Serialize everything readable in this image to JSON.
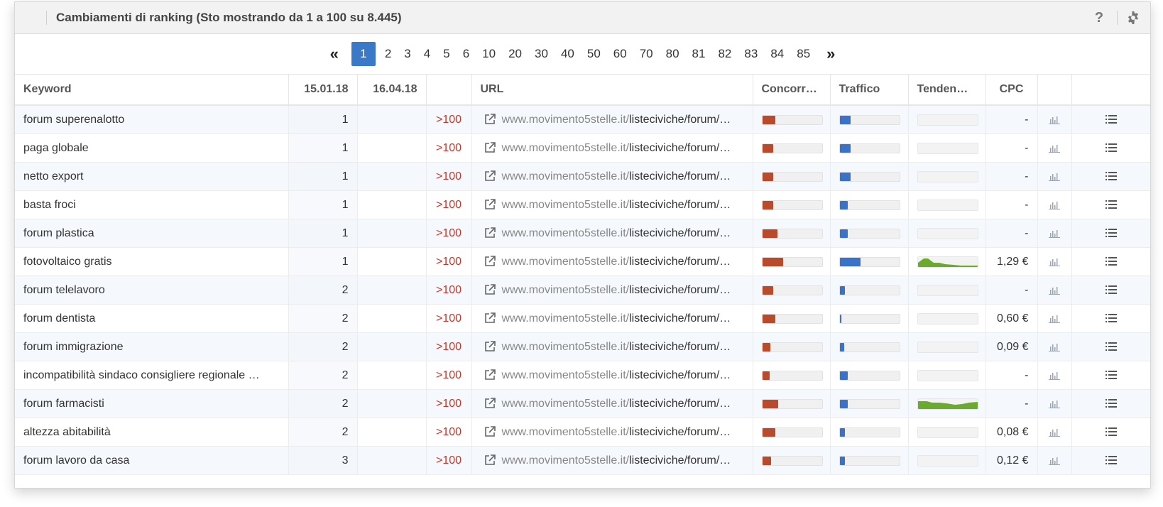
{
  "header": {
    "title": "Cambiamenti di ranking (Sto mostrando da 1 a 100 su 8.445)",
    "help_label": "?"
  },
  "pager": {
    "prev_label": "«",
    "next_label": "»",
    "pages": [
      "1",
      "2",
      "3",
      "4",
      "5",
      "6",
      "10",
      "20",
      "30",
      "40",
      "50",
      "60",
      "70",
      "80",
      "81",
      "82",
      "83",
      "84",
      "85"
    ],
    "current": "1"
  },
  "columns": {
    "keyword": "Keyword",
    "date1": "15.01.18",
    "date2": "16.04.18",
    "change": "",
    "url": "URL",
    "competition": "Concorr…",
    "traffic": "Traffico",
    "trend": "Tenden…",
    "cpc": "CPC"
  },
  "colors": {
    "accent": "#3a78c8",
    "competition_bar": "#b94a2c",
    "traffic_bar": "#3a72c9",
    "trend_fill": "#6aaa2e",
    "change_text": "#c0392b"
  },
  "rows": [
    {
      "keyword": "forum superenalotto",
      "d1": "1",
      "d2": "",
      "change": ">100",
      "domain": "www.movimento5stelle.it/",
      "path": "listeciviche/forum/…",
      "competition": 0.22,
      "traffic": 0.18,
      "trend": "",
      "cpc": "-"
    },
    {
      "keyword": "paga globale",
      "d1": "1",
      "d2": "",
      "change": ">100",
      "domain": "www.movimento5stelle.it/",
      "path": "listeciviche/forum/…",
      "competition": 0.19,
      "traffic": 0.19,
      "trend": "",
      "cpc": "-"
    },
    {
      "keyword": "netto export",
      "d1": "1",
      "d2": "",
      "change": ">100",
      "domain": "www.movimento5stelle.it/",
      "path": "listeciviche/forum/…",
      "competition": 0.18,
      "traffic": 0.18,
      "trend": "",
      "cpc": "-"
    },
    {
      "keyword": "basta froci",
      "d1": "1",
      "d2": "",
      "change": ">100",
      "domain": "www.movimento5stelle.it/",
      "path": "listeciviche/forum/…",
      "competition": 0.19,
      "traffic": 0.14,
      "trend": "",
      "cpc": "-"
    },
    {
      "keyword": "forum plastica",
      "d1": "1",
      "d2": "",
      "change": ">100",
      "domain": "www.movimento5stelle.it/",
      "path": "listeciviche/forum/…",
      "competition": 0.25,
      "traffic": 0.14,
      "trend": "",
      "cpc": "-"
    },
    {
      "keyword": "fotovoltaico gratis",
      "d1": "1",
      "d2": "",
      "change": ">100",
      "domain": "www.movimento5stelle.it/",
      "path": "listeciviche/forum/…",
      "competition": 0.35,
      "traffic": 0.35,
      "trend": "high",
      "cpc": "1,29 €"
    },
    {
      "keyword": "forum telelavoro",
      "d1": "2",
      "d2": "",
      "change": ">100",
      "domain": "www.movimento5stelle.it/",
      "path": "listeciviche/forum/…",
      "competition": 0.18,
      "traffic": 0.09,
      "trend": "",
      "cpc": "-"
    },
    {
      "keyword": "forum dentista",
      "d1": "2",
      "d2": "",
      "change": ">100",
      "domain": "www.movimento5stelle.it/",
      "path": "listeciviche/forum/…",
      "competition": 0.22,
      "traffic": 0.03,
      "trend": "",
      "cpc": "0,60 €"
    },
    {
      "keyword": "forum immigrazione",
      "d1": "2",
      "d2": "",
      "change": ">100",
      "domain": "www.movimento5stelle.it/",
      "path": "listeciviche/forum/…",
      "competition": 0.14,
      "traffic": 0.08,
      "trend": "",
      "cpc": "0,09 €"
    },
    {
      "keyword": "incompatibilità sindaco consigliere regionale …",
      "d1": "2",
      "d2": "",
      "change": ">100",
      "domain": "www.movimento5stelle.it/",
      "path": "listeciviche/forum/…",
      "competition": 0.12,
      "traffic": 0.14,
      "trend": "",
      "cpc": "-"
    },
    {
      "keyword": "forum farmacisti",
      "d1": "2",
      "d2": "",
      "change": ">100",
      "domain": "www.movimento5stelle.it/",
      "path": "listeciviche/forum/…",
      "competition": 0.27,
      "traffic": 0.14,
      "trend": "wide",
      "cpc": "-"
    },
    {
      "keyword": "altezza abitabilità",
      "d1": "2",
      "d2": "",
      "change": ">100",
      "domain": "www.movimento5stelle.it/",
      "path": "listeciviche/forum/…",
      "competition": 0.22,
      "traffic": 0.09,
      "trend": "",
      "cpc": "0,08 €"
    },
    {
      "keyword": "forum lavoro da casa",
      "d1": "3",
      "d2": "",
      "change": ">100",
      "domain": "www.movimento5stelle.it/",
      "path": "listeciviche/forum/…",
      "competition": 0.15,
      "traffic": 0.09,
      "trend": "",
      "cpc": "0,12 €"
    }
  ]
}
